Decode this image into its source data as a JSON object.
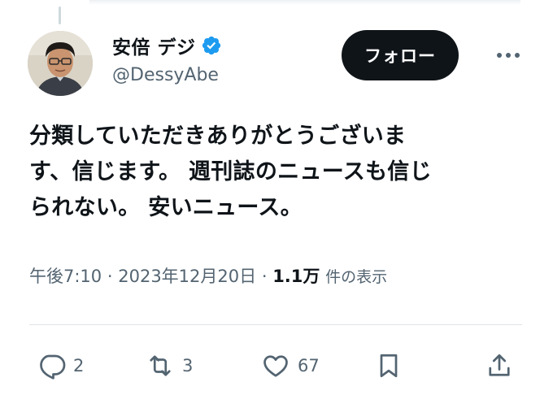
{
  "author": {
    "display_name": "安倍 デジ",
    "handle": "@DessyAbe",
    "verified": true,
    "verified_color": "#1d9bf0"
  },
  "header": {
    "follow_label": "フォロー",
    "more_icon": "more-horizontal-icon"
  },
  "tweet": {
    "lines": [
      "分類していただきありがとうございま",
      "す、信じます。 週刊誌のニュースも信じ",
      "られない。 安いニュース。"
    ]
  },
  "meta": {
    "time": "午後7:10",
    "separator": "·",
    "date": "2023年12月20日",
    "views_count": "1.1万",
    "views_label": "件の表示"
  },
  "actions": {
    "reply_count": "2",
    "retweet_count": "3",
    "like_count": "67"
  },
  "colors": {
    "text": "#0f1419",
    "secondary": "#536471",
    "follow_bg": "#0f1419"
  }
}
